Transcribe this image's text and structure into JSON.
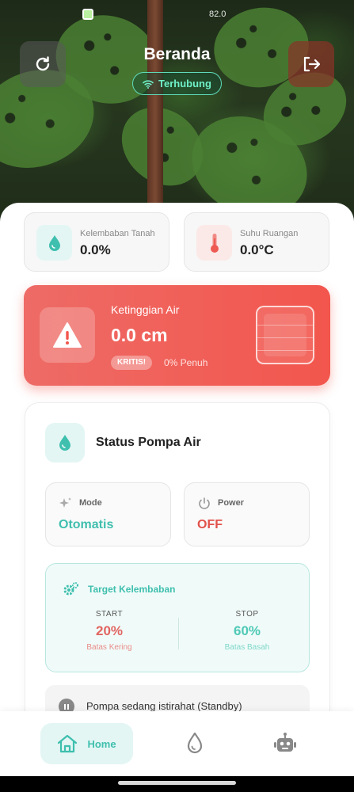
{
  "status_bar": {
    "battery_text": "82.0"
  },
  "header": {
    "title": "Beranda",
    "connection_label": "Terhubung",
    "refresh_icon": "refresh-icon",
    "logout_icon": "logout-icon"
  },
  "sensors": {
    "soil_moisture": {
      "label": "Kelembaban Tanah",
      "value": "0.0%",
      "icon": "water-drop-icon"
    },
    "room_temp": {
      "label": "Suhu Ruangan",
      "value": "0.0°C",
      "icon": "thermometer-icon"
    }
  },
  "water_level": {
    "label": "Ketinggian Air",
    "value": "0.0 cm",
    "badge": "KRITIS!",
    "fill_text": "0% Penuh",
    "fill_fraction": 0,
    "icon": "warning-icon"
  },
  "pump": {
    "title": "Status Pompa Air",
    "mode": {
      "label": "Mode",
      "value": "Otomatis"
    },
    "power": {
      "label": "Power",
      "value": "OFF"
    },
    "target": {
      "title": "Target Kelembaban",
      "start": {
        "head": "START",
        "value": "20%",
        "sub": "Batas Kering"
      },
      "stop": {
        "head": "STOP",
        "value": "60%",
        "sub": "Batas Basah"
      }
    },
    "standby_text": "Pompa sedang istirahat (Standby)"
  },
  "nav": {
    "home_label": "Home",
    "items": [
      "home-icon",
      "water-drop-icon",
      "robot-icon"
    ]
  },
  "colors": {
    "accent": "#3fbfae",
    "danger": "#f2564d",
    "start_color": "#e26461",
    "stop_color": "#4fc9b6"
  }
}
